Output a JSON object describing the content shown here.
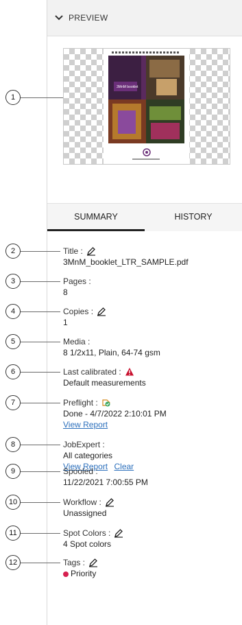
{
  "preview": {
    "title": "PREVIEW"
  },
  "thumbnail": {
    "cover_text": "3MnM booklet"
  },
  "tabs": [
    {
      "label": "SUMMARY",
      "active": true
    },
    {
      "label": "HISTORY",
      "active": false
    }
  ],
  "callouts": [
    "1",
    "2",
    "3",
    "4",
    "5",
    "6",
    "7",
    "8",
    "9",
    "10",
    "11",
    "12"
  ],
  "fields": {
    "title": {
      "label": "Title :",
      "value": "3MnM_booklet_LTR_SAMPLE.pdf",
      "icon": "pencil-icon"
    },
    "pages": {
      "label": "Pages :",
      "value": "8"
    },
    "copies": {
      "label": "Copies :",
      "value": "1",
      "icon": "pencil-icon"
    },
    "media": {
      "label": "Media :",
      "value": "8 1/2x11, Plain, 64-74 gsm"
    },
    "last_calibrated": {
      "label": "Last calibrated :",
      "value": "Default measurements",
      "icon": "warning-icon"
    },
    "preflight": {
      "label": "Preflight :",
      "value": "Done - 4/7/2022 2:10:01 PM",
      "link": "View Report",
      "icon": "preflight-status-icon"
    },
    "jobexpert": {
      "label": "JobExpert :",
      "value": "All categories",
      "link": "View Report",
      "link2": "Clear"
    },
    "spooled": {
      "label": "Spooled :",
      "value": "11/22/2021 7:00:55 PM"
    },
    "workflow": {
      "label": "Workflow :",
      "value": "Unassigned",
      "icon": "pencil-icon"
    },
    "spot_colors": {
      "label": "Spot Colors :",
      "value": "4 Spot colors",
      "icon": "pencil-icon"
    },
    "tags": {
      "label": "Tags :",
      "value": "Priority",
      "icon": "pencil-icon",
      "tag_color": "#d6204f"
    }
  },
  "colors": {
    "accent": "#222222",
    "link": "#2a6ebb",
    "warning": "#c8102e",
    "preflight_ok": "#3aa860"
  }
}
